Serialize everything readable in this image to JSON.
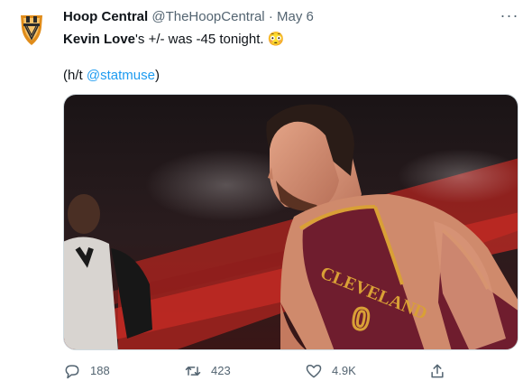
{
  "account": {
    "display_name": "Hoop Central",
    "handle": "@TheHoopCentral",
    "separator": "·",
    "date": "May 6"
  },
  "tweet": {
    "player_name": "Kevin Love",
    "text_rest": "'s +/- was -45 tonight.",
    "emoji": "😳",
    "hat_tip_prefix": "(h/t ",
    "hat_tip_user": "@statmuse",
    "hat_tip_suffix": ")"
  },
  "media": {
    "jersey_text": "CLEVELAND",
    "jersey_colors": {
      "wine": "#6f1d2e",
      "gold": "#d9a036"
    }
  },
  "actions": {
    "replies": "188",
    "retweets": "423",
    "likes": "4.9K",
    "icons": [
      "reply-icon",
      "retweet-icon",
      "like-icon",
      "share-icon"
    ]
  },
  "colors": {
    "link": "#1d9bf0",
    "muted": "#536471",
    "text": "#0f1419"
  }
}
